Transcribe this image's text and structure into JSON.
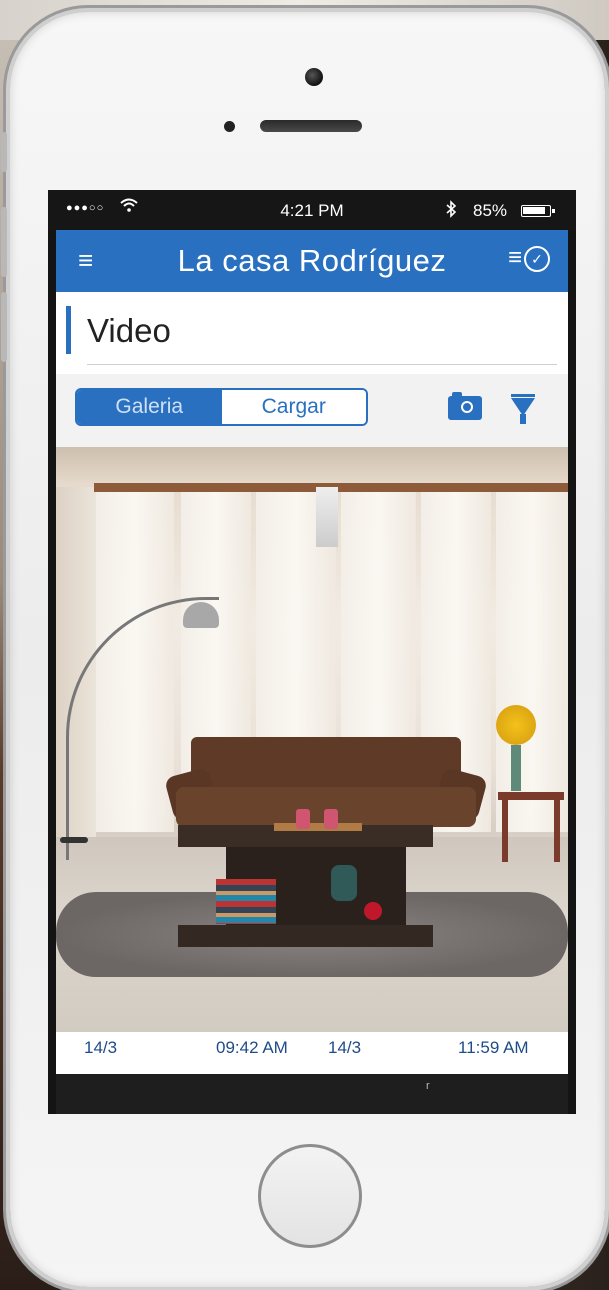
{
  "status_bar": {
    "signal": "●●●○○",
    "wifi_icon": "wifi-icon",
    "time": "4:21 PM",
    "bluetooth_icon": "bluetooth-icon",
    "battery_percent": "85%",
    "battery_level": 0.85
  },
  "nav": {
    "menu_icon": "≡",
    "title": "La casa Rodríguez",
    "tasks_icon": "≡",
    "check_icon": "✓"
  },
  "section": {
    "title": "Video"
  },
  "segmented": {
    "items": [
      "Galeria",
      "Cargar"
    ],
    "active_index": 0
  },
  "icons": {
    "camera_switch": "camera-switch-icon",
    "filter": "filter-icon"
  },
  "timeline": {
    "labels": [
      "14/3",
      "09:42 AM",
      "14/3",
      "11:59 AM"
    ]
  },
  "bottom_mark": "r",
  "colors": {
    "accent": "#2a70c1",
    "status_bar_bg": "#161616",
    "nav_bg": "#2a70c1"
  }
}
